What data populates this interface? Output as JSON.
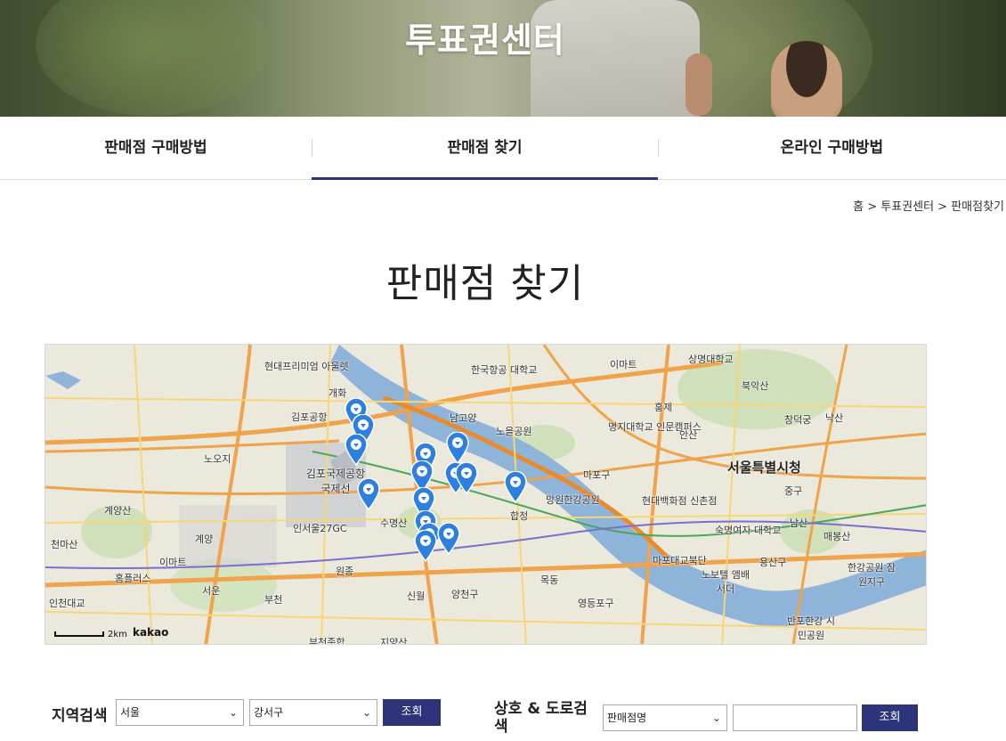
{
  "hero": {
    "title": "투표권센터"
  },
  "tabs": [
    {
      "label": "판매점 구매방법",
      "active": false
    },
    {
      "label": "판매점 찾기",
      "active": true
    },
    {
      "label": "온라인 구매방법",
      "active": false
    }
  ],
  "breadcrumb": "홈 > 투표권센터 > 판매점찾기",
  "page_title": "판매점 찾기",
  "map": {
    "labels": [
      "현대프리미엄 아울렛",
      "한국항공 대학교",
      "이마트",
      "상명대학교",
      "개화",
      "김포공항",
      "북악산",
      "남고양",
      "노을공원",
      "홍제",
      "명지대학교 인문캠퍼스",
      "안산",
      "창덕궁",
      "낙산",
      "노오지",
      "김포국제공항 국제선",
      "서울특별시청",
      "계양산",
      "계양",
      "인서울27GC",
      "수명산",
      "원종",
      "망원한강공원",
      "현대백화점 신촌점",
      "숙명여자 대학교",
      "남산",
      "매봉산",
      "천마산",
      "이마트",
      "홈플러스",
      "마포대교북단",
      "노보텔 앰배서더",
      "용산구",
      "한강공원 잠원지구",
      "서운",
      "부천",
      "신월",
      "양천구",
      "목동",
      "영등포구",
      "반포한강 시민공원",
      "인천대교",
      "부천종합",
      "지양산",
      "합정",
      "마포구",
      "중구"
    ],
    "scale": "2km",
    "brand": "kakao",
    "marker_count": 15
  },
  "search": {
    "region_label": "지역검색",
    "city_select": "서울",
    "district_select": "강서구",
    "region_button": "조회",
    "name_label": "상호 & 도로검색",
    "name_select": "판매점명",
    "name_input_value": "",
    "name_button": "조회"
  },
  "colors": {
    "accent": "#2e3479",
    "marker": "#2f7fe0"
  }
}
